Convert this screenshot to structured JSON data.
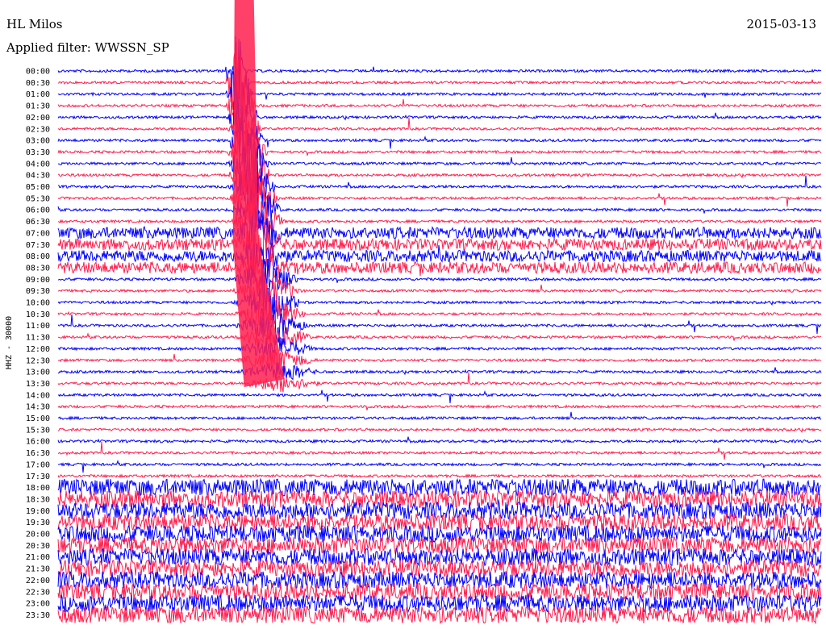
{
  "header": {
    "station": "HL Milos",
    "date": "2015-03-13",
    "filter": "Applied filter: WWSSN_SP"
  },
  "chart_data": {
    "type": "line",
    "title": "HL Milos",
    "ylabel": "HHZ - 30000",
    "row_labels": [
      "00:00",
      "00:30",
      "01:00",
      "01:30",
      "02:00",
      "02:30",
      "03:00",
      "03:30",
      "04:00",
      "04:30",
      "05:00",
      "05:30",
      "06:00",
      "06:30",
      "07:00",
      "07:30",
      "08:00",
      "08:30",
      "09:00",
      "09:30",
      "10:00",
      "10:30",
      "11:00",
      "11:30",
      "12:00",
      "12:30",
      "13:00",
      "13:30",
      "14:00",
      "14:30",
      "15:00",
      "15:30",
      "16:00",
      "16:30",
      "17:00",
      "17:30",
      "18:00",
      "18:30",
      "19:00",
      "19:30",
      "20:00",
      "20:30",
      "21:00",
      "21:30",
      "22:00",
      "22:30",
      "23:00",
      "23:30"
    ],
    "series_colors": [
      "#0000ff",
      "#ff1f4f"
    ],
    "x_minutes": [
      0,
      30
    ],
    "rows_per_hour": 2,
    "large_event": {
      "row": "00:00",
      "minute": 7,
      "decay_until_row": "13:30"
    },
    "noisy_periods": [
      {
        "from": "07:00",
        "to": "08:30",
        "level": 0.55
      },
      {
        "from": "18:00",
        "to": "23:30",
        "level": 0.9
      }
    ],
    "grid": false
  }
}
